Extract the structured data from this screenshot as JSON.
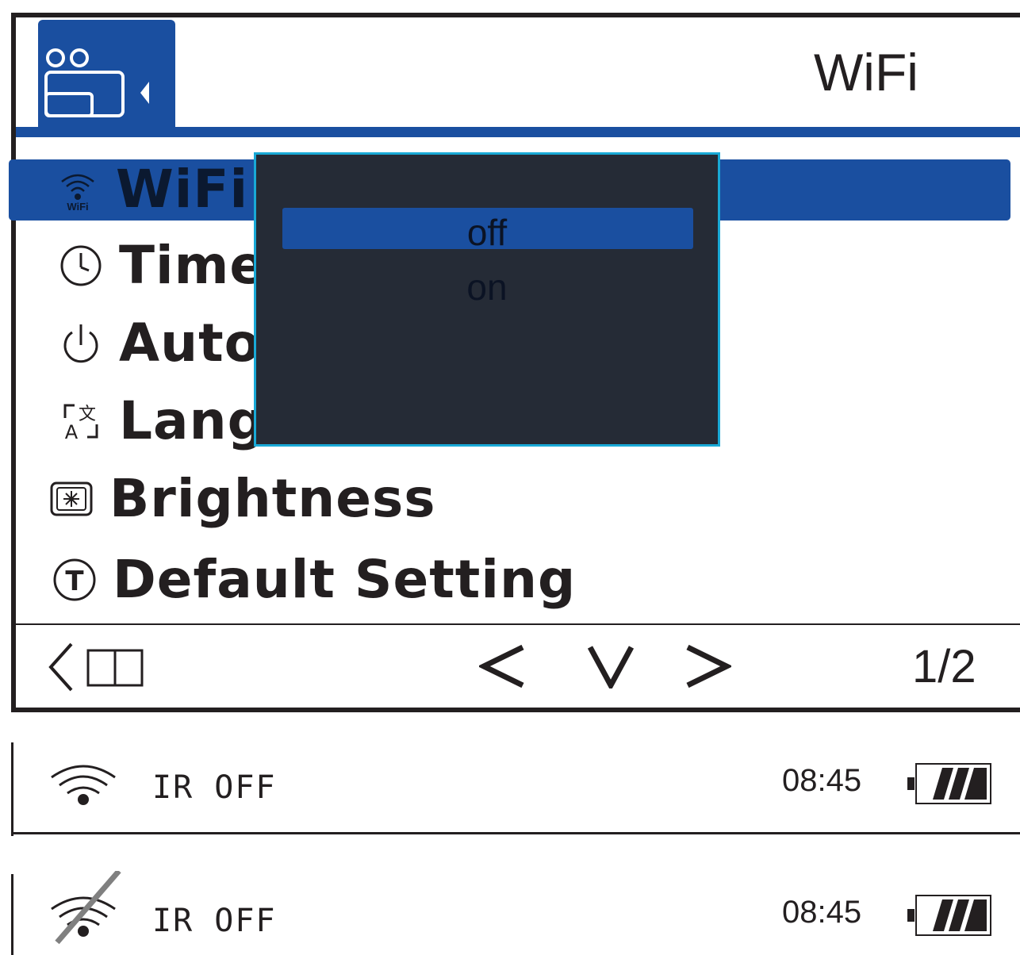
{
  "header": {
    "title": "WiFi",
    "camera_icon": "camera-menu-icon"
  },
  "menu": {
    "items": [
      {
        "label": "WiFi",
        "icon": "wifi-icon",
        "selected": true
      },
      {
        "label": "Time",
        "icon": "clock-icon"
      },
      {
        "label": "Auto",
        "icon": "power-icon"
      },
      {
        "label": "Lang",
        "icon": "language-icon"
      },
      {
        "label": "Brightness",
        "icon": "brightness-icon"
      },
      {
        "label": "Default Setting",
        "icon": "reset-icon"
      }
    ]
  },
  "popup": {
    "options": [
      "off",
      "on"
    ],
    "selected": "off"
  },
  "footer": {
    "back_icon": "back-icon",
    "prev": "<",
    "select": "V",
    "next": ">",
    "page": "1/2"
  },
  "status_bars": [
    {
      "wifi": "on",
      "ir_label": "IR OFF",
      "time": "08:45",
      "battery_level": 1.0
    },
    {
      "wifi": "off",
      "ir_label": "IR OFF",
      "time": "08:45",
      "battery_level": 1.0
    }
  ],
  "colors": {
    "accent": "#1a4fa0",
    "popup_bg": "#252b36",
    "popup_border": "#19a9d6",
    "text": "#231f20"
  }
}
